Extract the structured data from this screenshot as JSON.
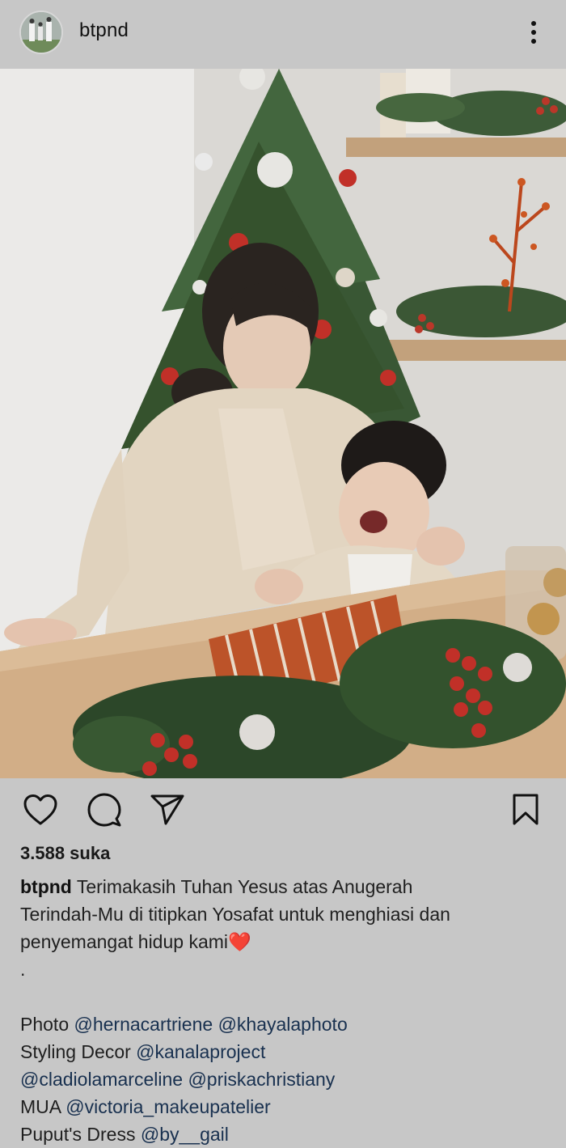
{
  "post": {
    "username": "btpnd",
    "likes": "3.588 suka"
  },
  "caption": {
    "owner": "btpnd",
    "line1": " Terimakasih Tuhan Yesus atas Anugerah",
    "line2": "Terindah-Mu di titipkan Yosafat untuk menghiasi dan",
    "line3": "penyemangat hidup kami",
    "emoji": "❤️",
    "dot": ".",
    "photo_label": "Photo ",
    "photo_mention1": "@hernacartriene",
    "photo_mention2": "@khayalaphoto",
    "styling_label": "Styling Decor ",
    "styling_mention1": "@kanalaproject",
    "styling_mention2": "@cladiolamarceline",
    "styling_mention3": "@priskachristiany",
    "mua_label": "MUA ",
    "mua_mention": "@victoria_makeupatelier",
    "dress_label": "Puput's Dress ",
    "dress_mention": "@by__gail"
  },
  "icons": {
    "like": "heart-icon",
    "comment": "comment-icon",
    "share": "send-icon",
    "save": "bookmark-icon",
    "more": "more-vertical-icon"
  },
  "colors": {
    "background": "#c7c7c7",
    "mention": "#18304f"
  }
}
